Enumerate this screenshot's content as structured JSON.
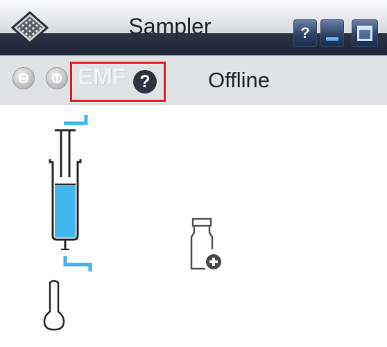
{
  "window": {
    "title": "Sampler",
    "titlebar_buttons": {
      "help": "?",
      "minimize_icon": "minimize-icon",
      "maximize_icon": "maximize-icon"
    },
    "app_icon": "sampler-tray-icon"
  },
  "toolbar": {
    "buttons": [
      {
        "icon": "minus-circle-icon",
        "enabled": false
      },
      {
        "icon": "power-circle-icon",
        "enabled": false
      }
    ],
    "emf_label": "EMF",
    "emf_help": "?",
    "status": "Offline",
    "status_color": "#b5b9c1"
  },
  "canvas": {
    "syringe_fill_color": "#3fb6ee",
    "connector_color": "#3fb6ee",
    "syringe_fill_level": 0.6,
    "icons": [
      "syringe-icon",
      "vial-add-icon",
      "temperature-icon"
    ]
  },
  "colors": {
    "highlight": "#e02228",
    "titlebar_dark": "#1c2535"
  }
}
